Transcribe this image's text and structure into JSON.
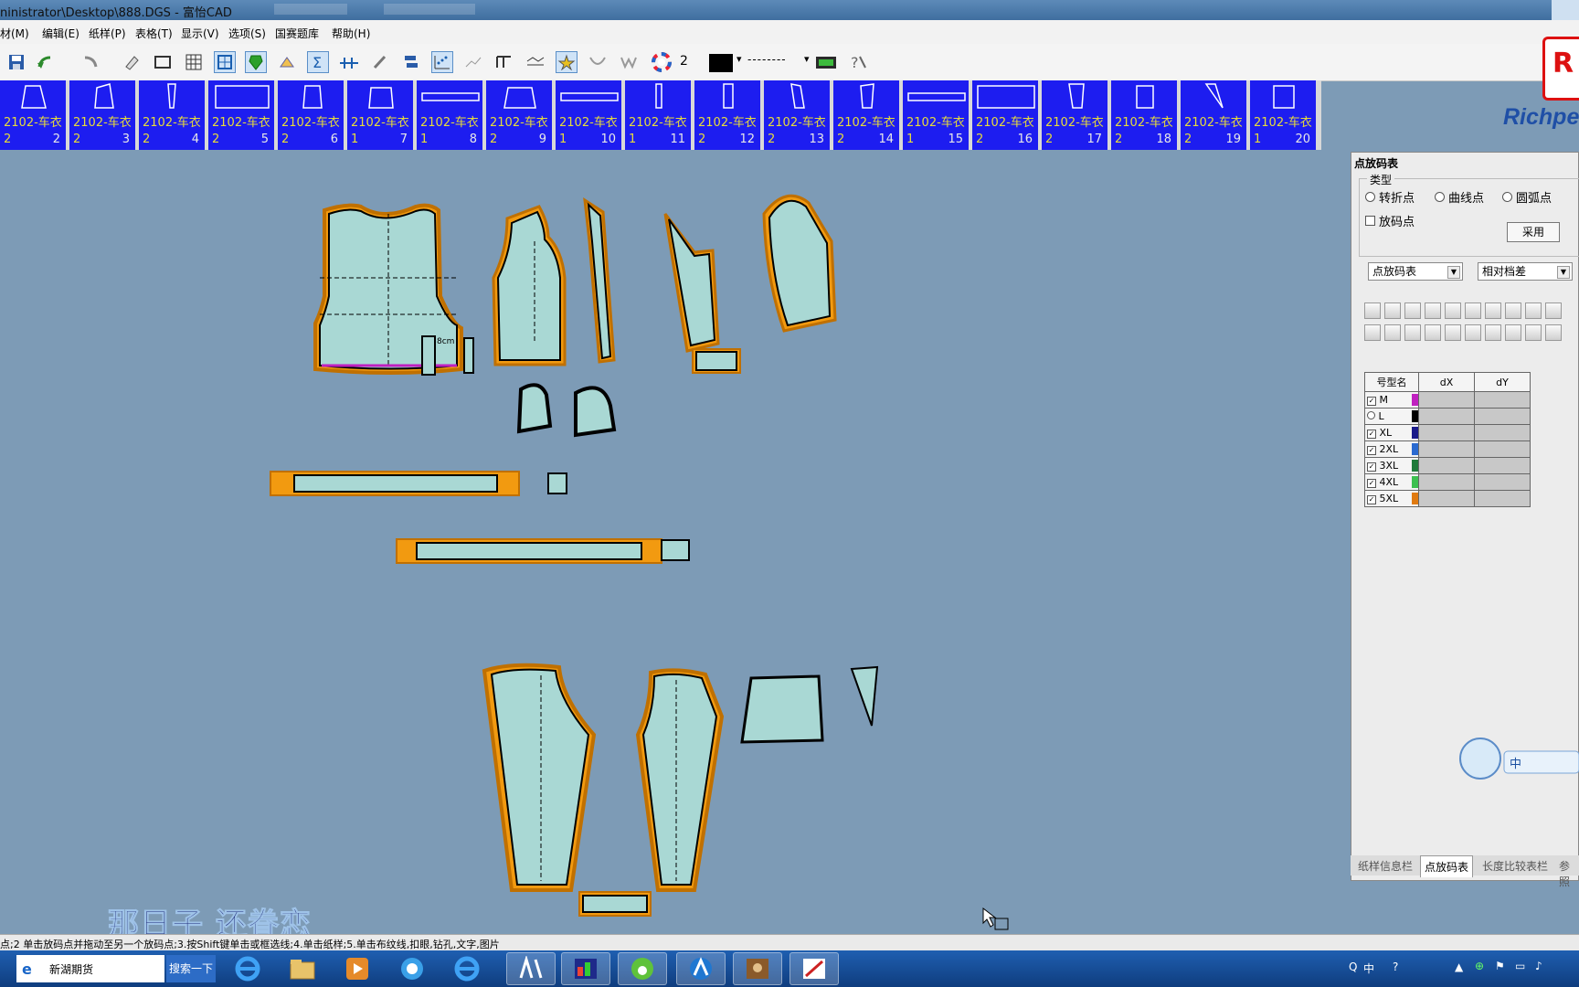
{
  "window": {
    "title": "ninistrator\\Desktop\\888.DGS - 富怡CAD"
  },
  "menu": [
    "材(M)",
    "编辑(E)",
    "纸样(P)",
    "表格(T)",
    "显示(V)",
    "选项(S)",
    "国赛题库",
    "帮助(H)"
  ],
  "toolbar": {
    "layer_value": "2",
    "line_style": "--------"
  },
  "brand": {
    "text": "Richpe"
  },
  "pieces": [
    {
      "name": "2102-车衣",
      "qty": "2",
      "no": "2"
    },
    {
      "name": "2102-车衣",
      "qty": "2",
      "no": "3"
    },
    {
      "name": "2102-车衣",
      "qty": "2",
      "no": "4"
    },
    {
      "name": "2102-车衣",
      "qty": "2",
      "no": "5"
    },
    {
      "name": "2102-车衣",
      "qty": "2",
      "no": "6"
    },
    {
      "name": "2102-车衣",
      "qty": "1",
      "no": "7"
    },
    {
      "name": "2102-车衣",
      "qty": "1",
      "no": "8"
    },
    {
      "name": "2102-车衣",
      "qty": "2",
      "no": "9"
    },
    {
      "name": "2102-车衣",
      "qty": "1",
      "no": "10"
    },
    {
      "name": "2102-车衣",
      "qty": "1",
      "no": "11"
    },
    {
      "name": "2102-车衣",
      "qty": "2",
      "no": "12"
    },
    {
      "name": "2102-车衣",
      "qty": "2",
      "no": "13"
    },
    {
      "name": "2102-车衣",
      "qty": "2",
      "no": "14"
    },
    {
      "name": "2102-车衣",
      "qty": "1",
      "no": "15"
    },
    {
      "name": "2102-车衣",
      "qty": "2",
      "no": "16"
    },
    {
      "name": "2102-车衣",
      "qty": "2",
      "no": "17"
    },
    {
      "name": "2102-车衣",
      "qty": "2",
      "no": "18"
    },
    {
      "name": "2102-车衣",
      "qty": "2",
      "no": "19"
    },
    {
      "name": "2102-车衣",
      "qty": "1",
      "no": "20"
    }
  ],
  "panel": {
    "title": "点放码表",
    "type_label": "类型",
    "radio_turn": "转折点",
    "radio_curve": "曲线点",
    "radio_arc": "圆弧点",
    "check_grade": "放码点",
    "apply": "采用",
    "select_table": "点放码表",
    "select_mode": "相对档差",
    "col_size": "号型名",
    "col_dx": "dX",
    "col_dy": "dY",
    "sizes": [
      {
        "name": "M",
        "color": "#c020c0",
        "checked": true
      },
      {
        "name": "L",
        "color": "#000000",
        "checked": false
      },
      {
        "name": "XL",
        "color": "#1a1a8a",
        "checked": true
      },
      {
        "name": "2XL",
        "color": "#2a6ad0",
        "checked": true
      },
      {
        "name": "3XL",
        "color": "#1f7a3a",
        "checked": true
      },
      {
        "name": "4XL",
        "color": "#3cc050",
        "checked": true
      },
      {
        "name": "5XL",
        "color": "#e07a10",
        "checked": true
      }
    ]
  },
  "tabs": [
    "纸样信息栏",
    "点放码表",
    "长度比较表栏",
    "参照"
  ],
  "status": "点;2 单击放码点并拖动至另一个放码点;3.按Shift键单击或框选线;4.单击纸样;5.单击布纹线,扣眼,钻孔,文字,图片",
  "caption": "那日子 还眷恋",
  "taskbar": {
    "search_text": "新湖期货",
    "search_button": "搜索一下",
    "ime": "中"
  },
  "drawing": {
    "label_8cm": "8cm"
  }
}
